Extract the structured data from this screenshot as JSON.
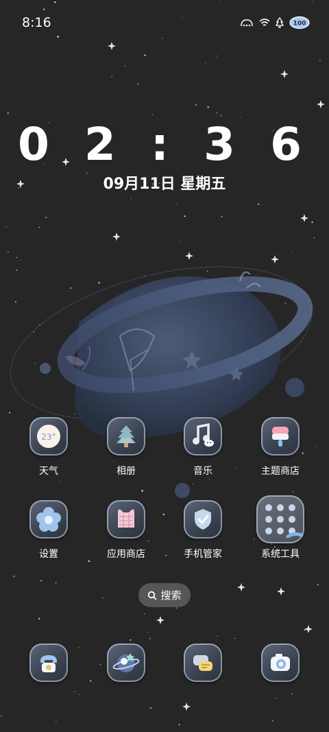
{
  "status_bar": {
    "time": "8:16",
    "battery": "100",
    "icons": [
      "nfc-icon",
      "wifi-icon",
      "signal-icon",
      "battery-icon"
    ]
  },
  "lockclock": {
    "time": "0 2 : 3 6",
    "date": "09月11日 星期五"
  },
  "apps": [
    {
      "label": "天气",
      "icon": "weather-icon",
      "weather_text": "23°"
    },
    {
      "label": "相册",
      "icon": "gallery-icon"
    },
    {
      "label": "音乐",
      "icon": "music-icon"
    },
    {
      "label": "主题商店",
      "icon": "theme-store-icon"
    },
    {
      "label": "设置",
      "icon": "settings-icon"
    },
    {
      "label": "应用商店",
      "icon": "app-store-icon"
    },
    {
      "label": "手机管家",
      "icon": "phone-manager-icon"
    },
    {
      "label": "系统工具",
      "icon": "system-tools-folder-icon"
    }
  ],
  "search": {
    "label": "搜索",
    "icon": "search-icon"
  },
  "dock": [
    {
      "icon": "phone-icon"
    },
    {
      "icon": "browser-icon"
    },
    {
      "icon": "messages-icon"
    },
    {
      "icon": "camera-icon"
    }
  ],
  "colors": {
    "background": "#262626",
    "icon_tile": "#4a5260",
    "icon_border": "#d2e1f5",
    "planet": "#3c4a66"
  }
}
